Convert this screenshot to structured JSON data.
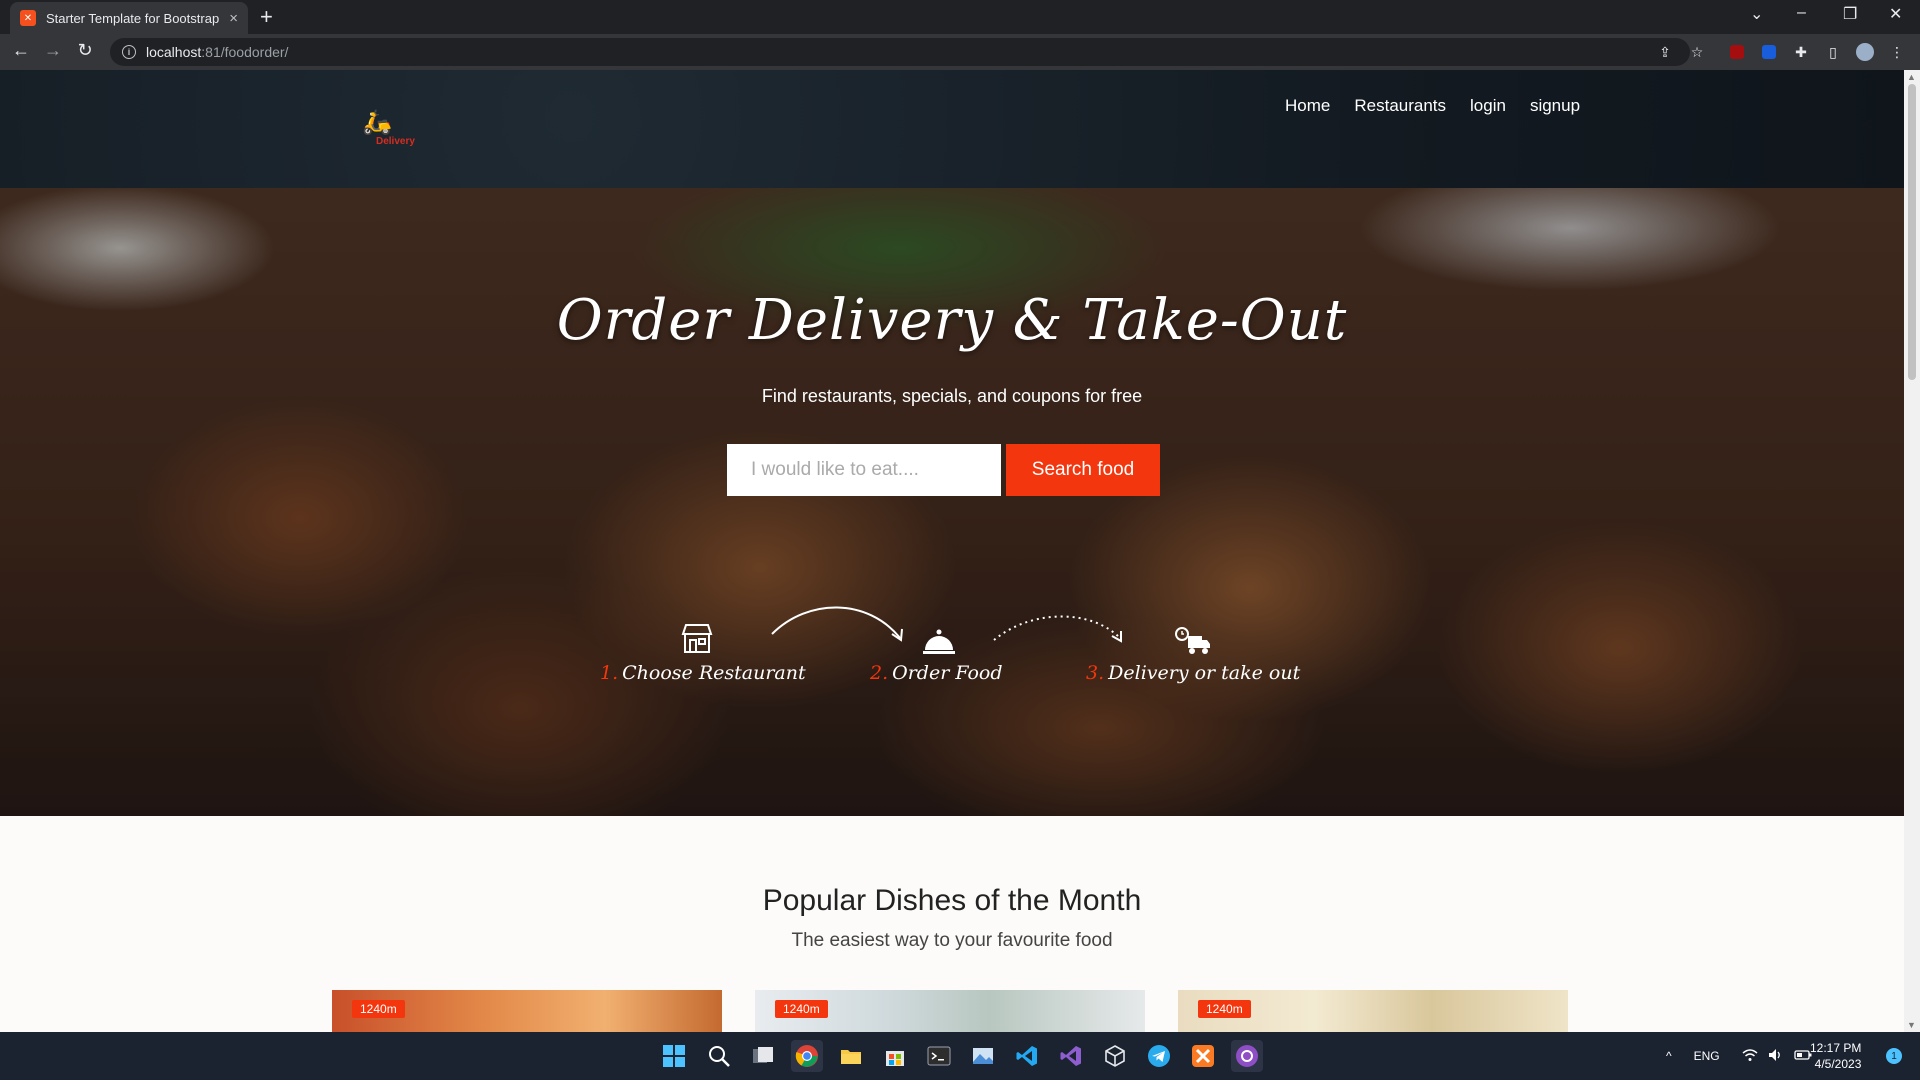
{
  "browser": {
    "tab_title": "Starter Template for Bootstrap",
    "tab_close": "×",
    "new_tab": "+",
    "url_host": "localhost",
    "url_path": ":81/foodorder/",
    "window_controls": [
      "⌄",
      "–",
      "❐",
      "✕"
    ]
  },
  "site": {
    "logo_text": "Delivery",
    "nav": [
      "Home",
      "Restaurants",
      "login",
      "signup"
    ]
  },
  "hero": {
    "title": "Order Delivery & Take-Out",
    "subtitle": "Find restaurants, specials, and coupons for free",
    "search_placeholder": "I would like to eat....",
    "search_button": "Search food",
    "steps": [
      {
        "num": "1.",
        "label": "Choose Restaurant",
        "icon": "store-icon"
      },
      {
        "num": "2.",
        "label": "Order Food",
        "icon": "cloche-icon"
      },
      {
        "num": "3.",
        "label": "Delivery or take out",
        "icon": "delivery-truck-icon"
      }
    ]
  },
  "popular": {
    "title": "Popular Dishes of the Month",
    "subtitle": "The easiest way to your favourite food",
    "cards": [
      {
        "badge": "1240m"
      },
      {
        "badge": "1240m"
      },
      {
        "badge": "1240m"
      }
    ]
  },
  "taskbar": {
    "language": "ENG",
    "time": "12:17 PM",
    "date": "4/5/2023",
    "notification_count": "1"
  },
  "colors": {
    "accent": "#f3360d",
    "header_bg": "#131a21",
    "taskbar_bg": "#1b2230"
  }
}
